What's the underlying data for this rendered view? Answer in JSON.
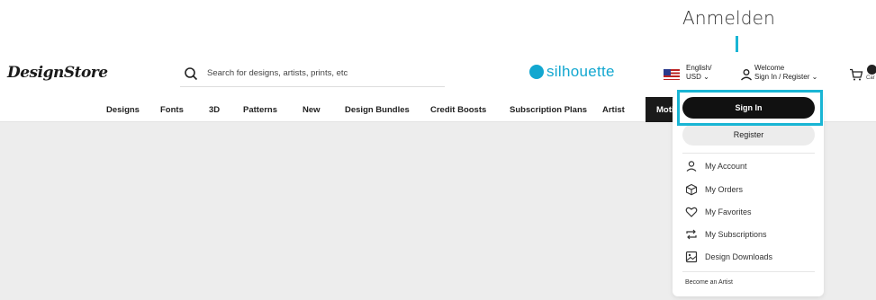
{
  "annotation": {
    "label": "Anmelden",
    "accent_color": "#19b5d4"
  },
  "header": {
    "logo_text": "DesignStore",
    "search_placeholder": "Search for designs, artists, prints, etc",
    "brand_text": "silhouette",
    "brand_color": "#12a7d0",
    "language_line1": "English/",
    "language_line2": "USD ⌄",
    "welcome_line1": "Welcome",
    "welcome_line2": "Sign In / Register ⌄",
    "cart_label": "Car"
  },
  "nav": {
    "items": [
      "Designs",
      "Fonts",
      "3D",
      "Patterns",
      "New",
      "Design Bundles",
      "Credit Boosts",
      "Subscription Plans",
      "Artist"
    ],
    "highlight_item": "Moti"
  },
  "dropdown": {
    "signin_label": "Sign In",
    "register_label": "Register",
    "items": [
      {
        "label": "My Account",
        "icon": "user-icon"
      },
      {
        "label": "My Orders",
        "icon": "box-icon"
      },
      {
        "label": "My Favorites",
        "icon": "heart-icon"
      },
      {
        "label": "My Subscriptions",
        "icon": "repeat-icon"
      },
      {
        "label": "Design Downloads",
        "icon": "image-icon"
      }
    ],
    "become_artist": "Become an Artist"
  }
}
